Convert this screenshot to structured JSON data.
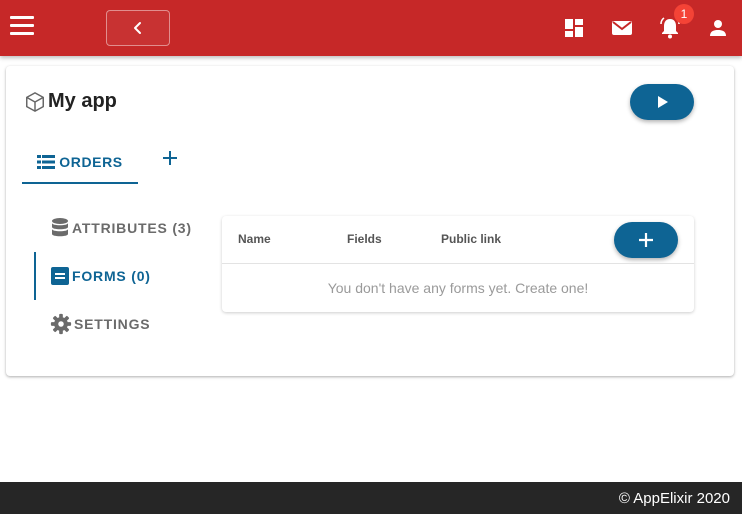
{
  "header": {
    "notifications_count": "1",
    "icons": [
      "menu-icon",
      "chevron-left-icon",
      "dashboard-icon",
      "mail-icon",
      "bell-icon",
      "account-icon"
    ],
    "bar_color": "#c62828"
  },
  "app": {
    "title": "My app",
    "accent_color": "#0e6494"
  },
  "tabs": [
    {
      "label": "ORDERS",
      "icon": "list-icon",
      "active": true
    }
  ],
  "side_nav": [
    {
      "label": "ATTRIBUTES (3)",
      "icon": "database-icon",
      "active": false
    },
    {
      "label": "FORMS (0)",
      "icon": "form-icon",
      "active": true
    },
    {
      "label": "SETTINGS",
      "icon": "gear-icon",
      "active": false
    }
  ],
  "forms_table": {
    "columns": [
      "Name",
      "Fields",
      "Public link"
    ],
    "empty_message": "You don't have any forms yet. Create one!"
  },
  "footer": {
    "text": "© AppElixir 2020"
  }
}
